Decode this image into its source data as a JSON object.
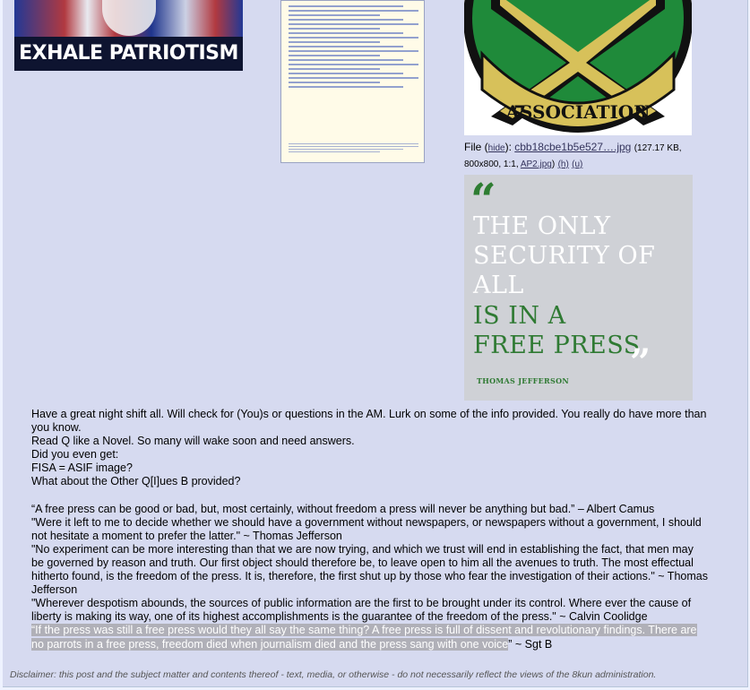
{
  "images": {
    "img1": {
      "caption": "EXHALE PATRIOTISM"
    },
    "img3": {
      "text": "ASSOCIATION",
      "num_left": "7",
      "num_right": "8"
    },
    "img4": {
      "open_quote": "“",
      "lines": [
        "THE ONLY",
        "SECURITY OF",
        "ALL",
        "IS IN A",
        "FREE PRESS"
      ],
      "close_quote": "”",
      "author": "THOMAS JEFFERSON",
      "colors": {
        "background": "#cfd1d6",
        "white_text": "#ffffff",
        "green_text": "#2f7a33"
      }
    }
  },
  "file": {
    "prefix": "File (",
    "hide_link": "hide",
    "middle": "): ",
    "filename": "cbb18cbe1b5e527….jpg",
    "meta": "(127.17 KB, 800x800, 1:1, ",
    "orig_name": "AP2.jpg",
    "close": ")",
    "h_link": "(h)",
    "u_link": "(u)"
  },
  "post": {
    "lines1": [
      "Have a great night shift all. Will check for (You)s or questions in the AM. Lurk on some of the info provided. You really do have more than you know.",
      "Read Q like a Novel. So many will wake soon and need answers.",
      "Did you even get:",
      "FISA = ASIF image?",
      "What about the Other Q[I]ues B provided?"
    ],
    "quotes": [
      "“A free press can be good or bad, but, most certainly, without freedom a press will never be anything but bad.”  – Albert Camus",
      "\"Were it left to me to decide whether we should have a government without newspapers, or newspapers without a government, I should not hesitate a moment to prefer the latter.\" ~ Thomas Jefferson",
      "\"No experiment can be more interesting than that we are now trying, and which we trust will end in establishing the fact, that men may be governed by reason and truth. Our first object should therefore be, to leave open to him all the avenues to truth. The most effectual hitherto found, is the freedom of the press. It is, therefore, the first shut up by those who fear the investigation of their actions.\" ~ Thomas Jefferson",
      "\"Wherever despotism abounds, the sources of public information are the first to be brought under its control. Where ever the cause of liberty is making its way, one of its highest accomplishments is the guarantee of the freedom of the press.\" ~ Calvin Coolidge"
    ],
    "last_highlighted": "“If the press was still a free press would they all say the same thing? A free press is full of dissent and revolutionary findings. There are no parrots in a free press, freedom died when journalism died and the press sang with one voice",
    "last_tail": "” ~ Sgt B"
  },
  "disclaimer": "Disclaimer: this post and the subject matter and contents thereof - text, media, or otherwise - do not necessarily reflect the views of the 8kun administration."
}
